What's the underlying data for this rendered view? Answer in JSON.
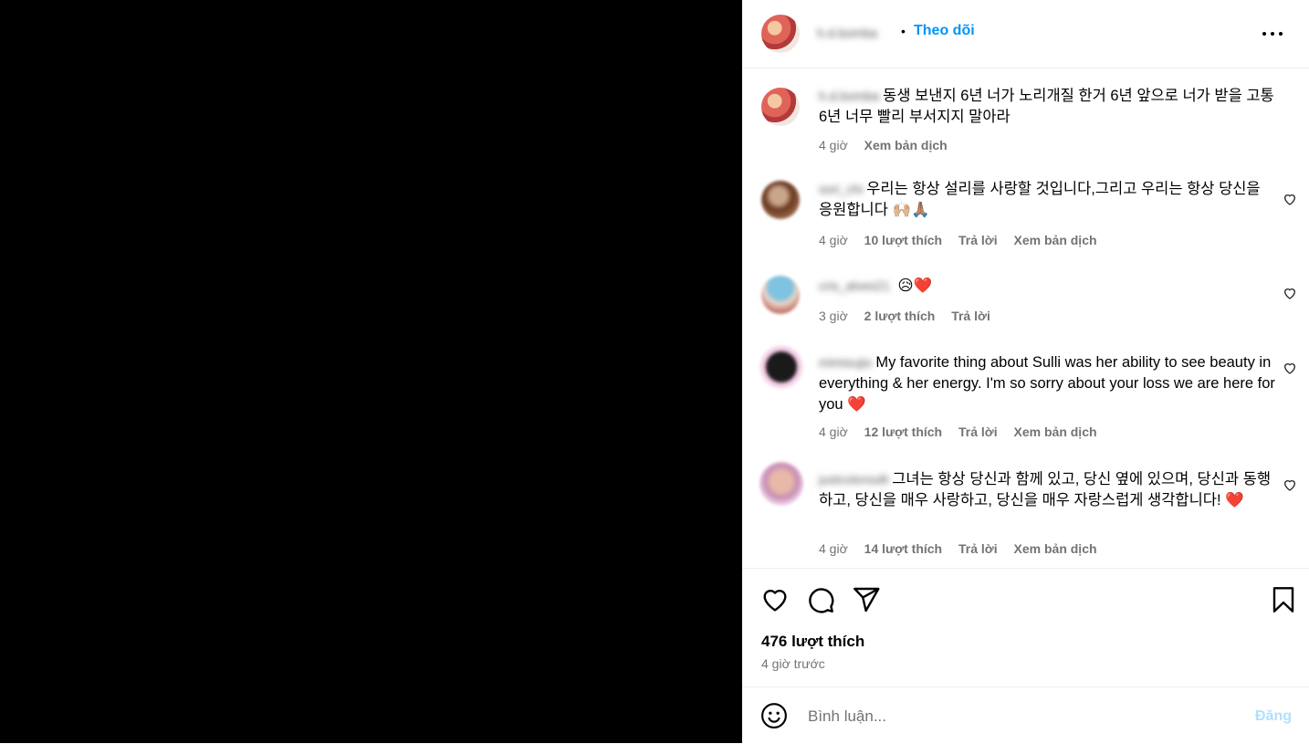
{
  "post": {
    "owner_username": "h.d.bomba",
    "separator": "•",
    "follow_label": "Theo dõi",
    "caption": {
      "username": "h.d.bomba",
      "text": "동생 보낸지 6년 너가 노리개질 한거 6년 앞으로 너가 받을 고통 6년 너무 빨리 부서지지 말아라",
      "time": "4 giờ",
      "translate": "Xem bản dịch"
    },
    "comments": [
      {
        "username": "sori_chi",
        "text": "우리는 항상 설리를 사랑할 것입니다,그리고 우리는 항상 당신을 응원합니다",
        "emoji": "🙌🏼🙏🏽",
        "time": "4 giờ",
        "likes": "10 lượt thích",
        "reply": "Trả lời",
        "translate": "Xem bản dịch"
      },
      {
        "username": "cris_alves21",
        "text": "",
        "emoji": "😥❤️",
        "time": "3 giờ",
        "likes": "2 lượt thích",
        "reply": "Trả lời",
        "translate": ""
      },
      {
        "username": "mimisujio",
        "text": "My favorite thing about Sulli was her ability to see beauty in everything & her energy. I'm so sorry about your loss we are here for you",
        "emoji": "❤️",
        "time": "4 giờ",
        "likes": "12 lượt thích",
        "reply": "Trả lời",
        "translate": "Xem bản dịch"
      },
      {
        "username": "justcolorsulli",
        "text": "그녀는 항상 당신과 함께 있고, 당신 옆에 있으며, 당신과 동행하고, 당신을 매우 사랑하고, 당신을 매우 자랑스럽게 생각합니다!",
        "emoji": "❤️",
        "time": "4 giờ",
        "likes": "14 lượt thích",
        "reply": "Trả lời",
        "translate": "Xem bản dịch"
      }
    ],
    "like_count": "476 lượt thích",
    "posted_ago": "4 giờ trước"
  },
  "composer": {
    "placeholder": "Bình luận...",
    "post_label": "Đăng"
  },
  "colors": {
    "accent": "#0095f6",
    "muted": "#737373",
    "post_disabled": "#b2dffc",
    "heart_red": "#e0245e"
  },
  "icons": [
    "more-options-icon",
    "heart-icon",
    "comment-icon",
    "share-icon",
    "save-icon",
    "emoji-icon"
  ]
}
